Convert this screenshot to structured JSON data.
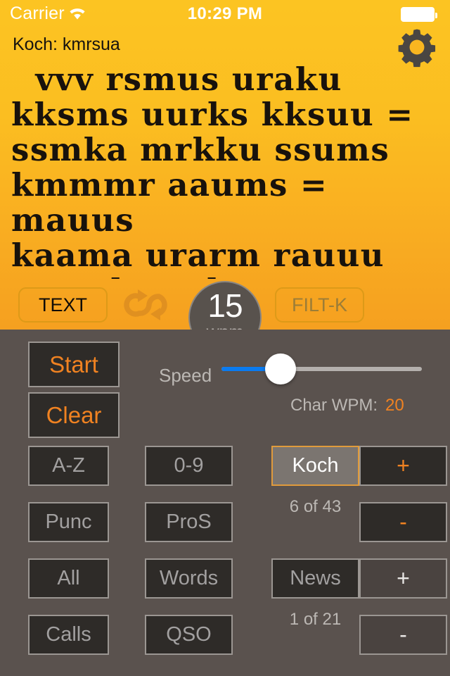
{
  "status_bar": {
    "carrier": "Carrier",
    "time": "10:29 PM",
    "wifi_icon": "wifi-icon",
    "battery_icon": "battery-icon"
  },
  "nav": {
    "title": "Koch: kmrsua",
    "settings_icon": "gear-icon"
  },
  "practice_text": "  vvv rsmus uraku\nkksms uurks kksuu =\nssmka mrkku ssums\nkmmmr aaums = mauus\nkaama urarm rauuu\naaamk = akuma mrusa",
  "control_strip": {
    "text_button": "TEXT",
    "repeat_icon": "repeat-loop-icon",
    "filter_button": "FILT-K",
    "wpm_value": "15",
    "wpm_unit": "wpm"
  },
  "transport": {
    "start_label": "Start",
    "clear_label": "Clear"
  },
  "speed": {
    "label": "Speed",
    "fill_percent": 27,
    "char_wpm_label": "Char WPM:",
    "char_wpm_value": "20"
  },
  "mode_grid": {
    "col1": [
      {
        "label": "A-Z",
        "selected": false
      },
      {
        "label": "Punc",
        "selected": false
      },
      {
        "label": "All",
        "selected": false
      },
      {
        "label": "Calls",
        "selected": false
      }
    ],
    "col2": [
      {
        "label": "0-9",
        "selected": false
      },
      {
        "label": "ProS",
        "selected": false
      },
      {
        "label": "Words",
        "selected": false
      },
      {
        "label": "QSO",
        "selected": false
      }
    ],
    "koch_button": "Koch",
    "koch_counter": "6 of 43",
    "koch_plus": "+",
    "koch_minus": "-",
    "news_button": "News",
    "news_counter": "1 of 21",
    "news_plus": "+",
    "news_minus": "-"
  },
  "colors": {
    "panel_orange_top": "#fcc422",
    "panel_orange_bottom": "#f5a020",
    "panel_gray": "#5a524e",
    "accent_orange": "#f08221",
    "slider_blue": "#0a7bf0",
    "button_dark": "#2e2b28"
  }
}
